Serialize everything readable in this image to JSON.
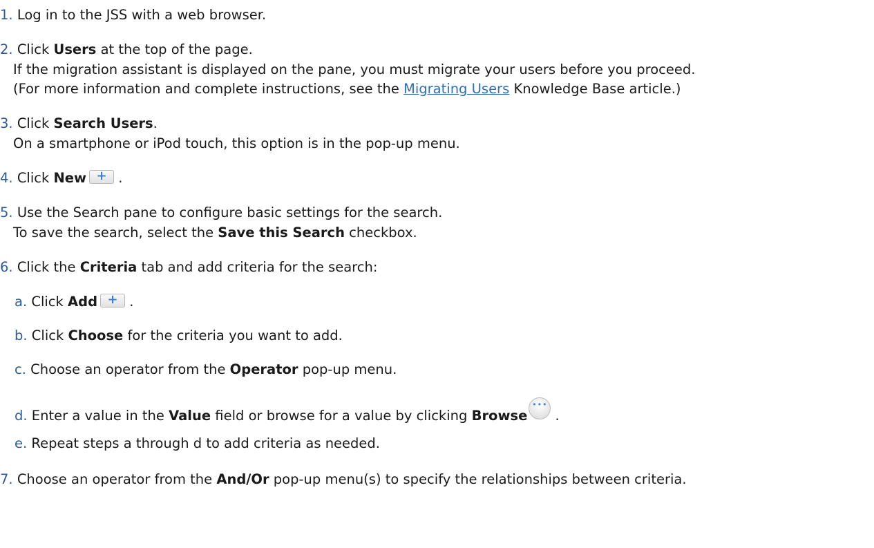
{
  "steps": [
    {
      "num": "1.",
      "text": "Log in to the JSS with a web browser."
    },
    {
      "num": "2.",
      "pre": "Click ",
      "bold": "Users",
      "post": " at the top of the page.",
      "line2": "If the migration assistant is displayed on the pane, you must migrate your users before you proceed.",
      "line3_pre": "(For more information and complete instructions, see the ",
      "line3_link": "Migrating Users",
      "line3_post": " Knowledge Base article.)"
    },
    {
      "num": "3.",
      "pre": "Click ",
      "bold": "Search Users",
      "post": ".",
      "line2": "On a smartphone or iPod touch, this option is in the pop-up menu."
    },
    {
      "num": "4.",
      "pre": "Click ",
      "bold": "New",
      "post": " ."
    },
    {
      "num": "5.",
      "text": "Use the Search pane to configure basic settings for the search.",
      "line2_pre": "To save the search, select the ",
      "line2_bold": "Save this Search",
      "line2_post": " checkbox."
    },
    {
      "num": "6.",
      "pre": "Click the ",
      "bold": "Criteria",
      "post": " tab and add criteria for the search:"
    },
    {
      "num": "7.",
      "pre": "Choose an operator from the ",
      "bold": "And/Or",
      "post": " pop-up menu(s) to specify the relationships between criteria."
    }
  ],
  "substeps": [
    {
      "letter": "a.",
      "pre": "Click ",
      "bold": "Add",
      "post": " ."
    },
    {
      "letter": "b.",
      "pre": "Click ",
      "bold": "Choose",
      "post": " for the criteria you want to add."
    },
    {
      "letter": "c.",
      "pre": "Choose an operator from the ",
      "bold": "Operator",
      "post": " pop-up menu."
    },
    {
      "letter": "d.",
      "pre": "Enter a value in the ",
      "bold": "Value",
      "mid": " field or browse for a value by clicking ",
      "bold2": "Browse",
      "post": " ."
    },
    {
      "letter": "e.",
      "text": "Repeat steps a through d to add criteria as needed."
    }
  ],
  "icons": {
    "add": "plus-button-icon",
    "browse": "ellipsis-browse-icon"
  },
  "colors": {
    "number": "#2e5b97",
    "link": "#2f6fb7",
    "text": "#1a1a1a"
  }
}
